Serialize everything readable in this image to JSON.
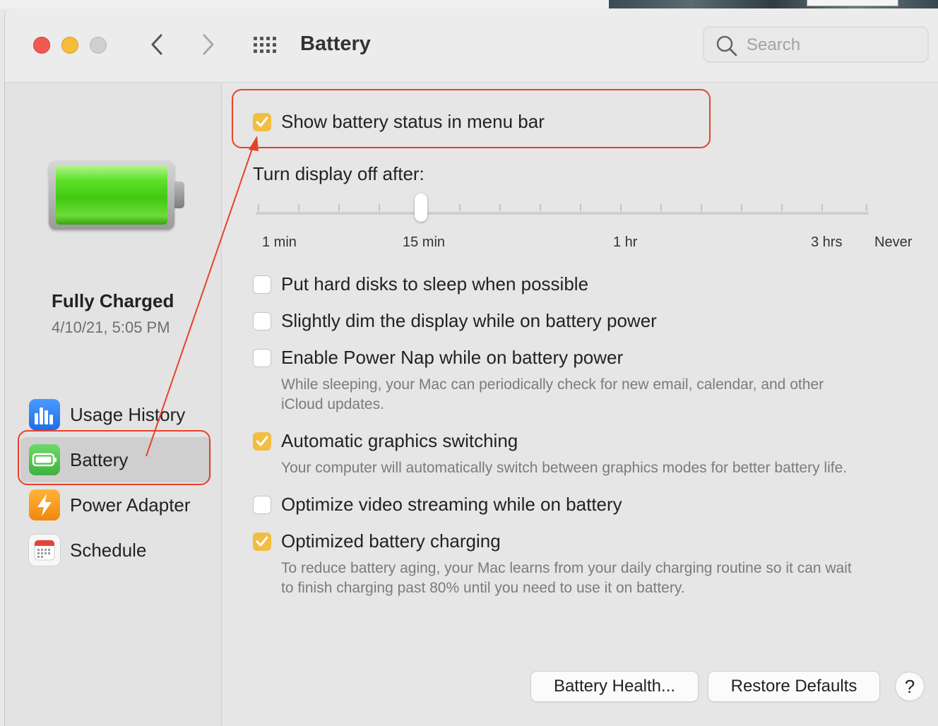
{
  "window": {
    "title": "Battery",
    "search_placeholder": "Search"
  },
  "sidebar": {
    "status_title": "Fully Charged",
    "status_date": "4/10/21, 5:05 PM",
    "items": [
      {
        "label": "Usage History",
        "icon": "bar-chart-icon",
        "color": "#2f7ff0"
      },
      {
        "label": "Battery",
        "icon": "battery-icon",
        "color": "#54c254",
        "selected": true
      },
      {
        "label": "Power Adapter",
        "icon": "lightning-bolt-icon",
        "color": "#f39a1c"
      },
      {
        "label": "Schedule",
        "icon": "calendar-icon",
        "color": "#e04034"
      }
    ]
  },
  "settings": {
    "show_status": {
      "label": "Show battery status in menu bar",
      "checked": true
    },
    "display_off": {
      "label": "Turn display off after:",
      "tick_labels": [
        "1 min",
        "15 min",
        "1 hr",
        "3 hrs",
        "Never"
      ],
      "value": "15 min"
    },
    "hard_disks": {
      "label": "Put hard disks to sleep when possible",
      "checked": false
    },
    "dim_display": {
      "label": "Slightly dim the display while on battery power",
      "checked": false
    },
    "power_nap": {
      "label": "Enable Power Nap while on battery power",
      "checked": false,
      "description_line1": "While sleeping, your Mac can periodically check for new email, calendar, and other",
      "description_line2": "iCloud updates."
    },
    "graphics_switching": {
      "label": "Automatic graphics switching",
      "checked": true,
      "description": "Your computer will automatically switch between graphics modes for better battery life."
    },
    "video_streaming": {
      "label": "Optimize video streaming while on battery",
      "checked": false
    },
    "optimized_charging": {
      "label": "Optimized battery charging",
      "checked": true,
      "description_line1": "To reduce battery aging, your Mac learns from your daily charging routine so it can wait",
      "description_line2": "to finish charging past 80% until you need to use it on battery."
    }
  },
  "buttons": {
    "battery_health": "Battery Health...",
    "restore_defaults": "Restore Defaults",
    "help": "?"
  },
  "colors": {
    "accent_checkbox": "#f2be42",
    "annotation": "#e8412a",
    "battery_green": "#41c811"
  }
}
